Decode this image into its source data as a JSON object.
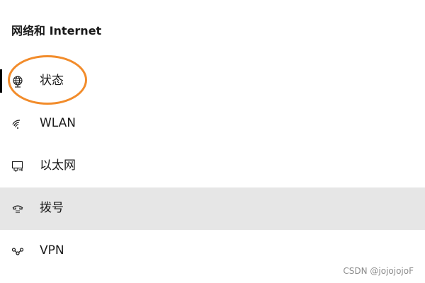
{
  "header": {
    "title": "网络和 Internet"
  },
  "nav": {
    "items": [
      {
        "label": "状态",
        "icon": "globe-icon",
        "selected": true
      },
      {
        "label": "WLAN",
        "icon": "wifi-icon",
        "selected": false
      },
      {
        "label": "以太网",
        "icon": "ethernet-icon",
        "selected": false
      },
      {
        "label": "拨号",
        "icon": "dialup-icon",
        "selected": false,
        "hovered": true
      },
      {
        "label": "VPN",
        "icon": "vpn-icon",
        "selected": false
      }
    ]
  },
  "annotation": {
    "color": "#f28c2b"
  },
  "watermark": {
    "text": "CSDN @jojojojoF"
  },
  "colors": {
    "hover_background": "#e6e6e6",
    "text": "#1a1a1a",
    "accent_bar": "#000000"
  }
}
